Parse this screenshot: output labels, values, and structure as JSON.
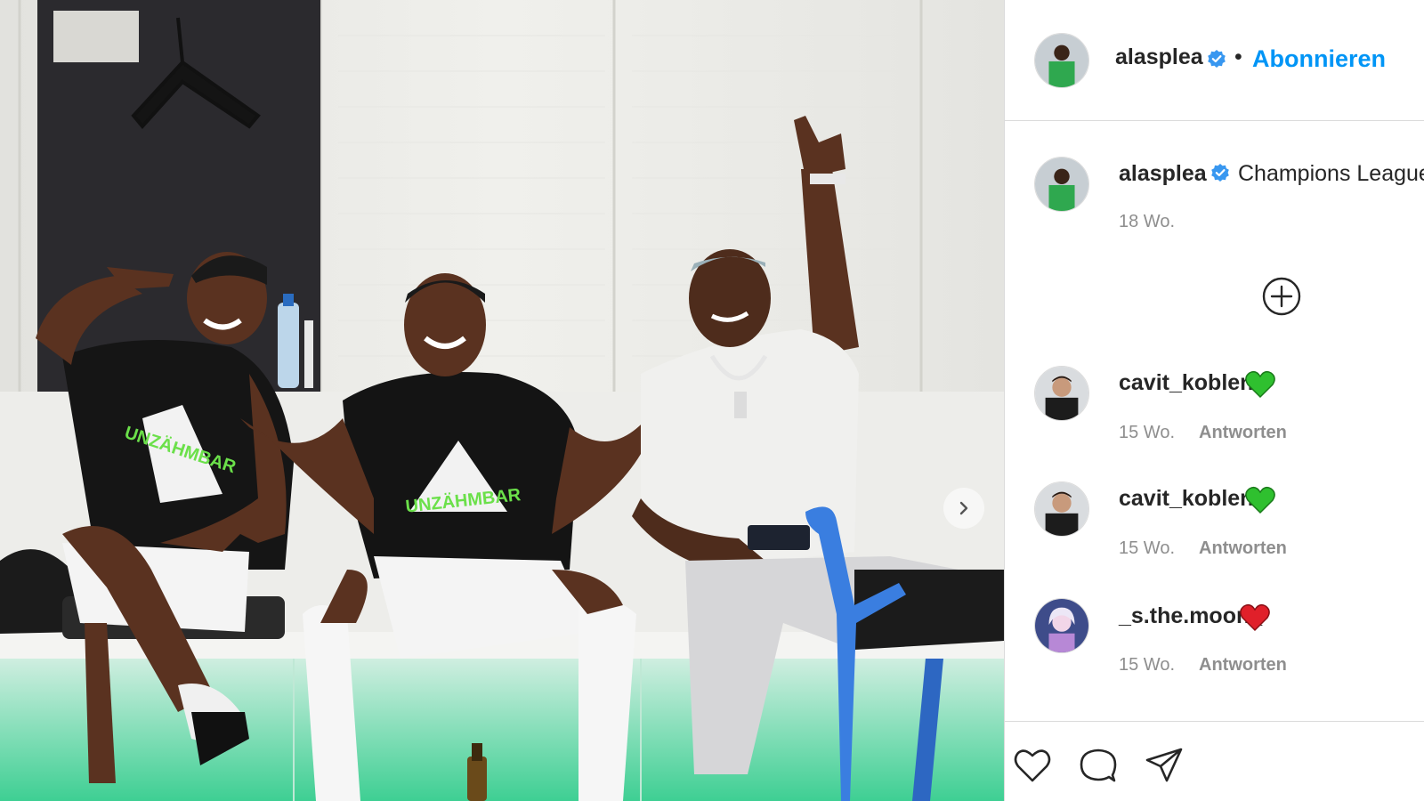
{
  "post": {
    "author": "alasplea",
    "follow_label": "Abonnieren",
    "separator": "•",
    "caption_text": "Champions League",
    "caption_time": "18 Wo.",
    "next_icon": "chevron-right-icon",
    "load_more_icon": "plus-circle-icon"
  },
  "comments": [
    {
      "user": "cavit_koblenz",
      "emoji": "green-heart",
      "time": "15 Wo.",
      "reply": "Antworten"
    },
    {
      "user": "cavit_koblenz",
      "emoji": "green-heart",
      "time": "15 Wo.",
      "reply": "Antworten"
    },
    {
      "user": "_s.the.moon_",
      "emoji": "red-heart",
      "time": "15 Wo.",
      "reply": "Antworten"
    }
  ],
  "actions": [
    "heart-icon",
    "comment-icon",
    "share-icon"
  ],
  "colors": {
    "link_blue": "#0095f6",
    "text": "#262626",
    "muted": "#8e8e8e",
    "border": "#dbdbdb",
    "green_heart": "#2fc02f",
    "red_heart": "#e0202a",
    "verified": "#3897f0"
  }
}
